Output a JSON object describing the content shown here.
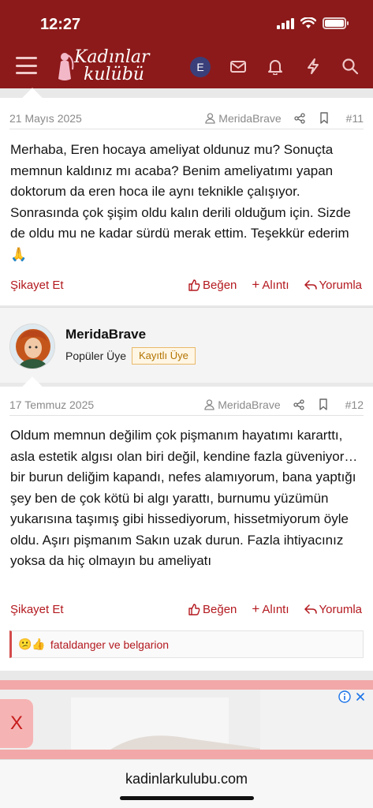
{
  "status_bar": {
    "time": "12:27"
  },
  "header": {
    "logo_line1": "Kadınlar",
    "logo_line2": "kulübü",
    "user_initial": "E"
  },
  "posts": [
    {
      "date": "21 Mayıs 2025",
      "author": "MeridaBrave",
      "number": "#11",
      "body": "Merhaba, Eren hocaya ameliyat oldunuz mu? Sonuçta memnun kaldınız mı acaba? Benim ameliyatımı yapan doktorum da eren hoca ile aynı teknikle çalışıyor. Sonrasında çok şişim oldu kalın derili olduğum için. Sizde de oldu mu ne kadar sürdü merak ettim. Teşekkür ederim 🙏",
      "report": "Şikayet Et",
      "like": "Beğen",
      "quote": "Alıntı",
      "reply": "Yorumla"
    },
    {
      "date": "17 Temmuz 2025",
      "author": "MeridaBrave",
      "number": "#12",
      "body": "Oldum memnun değilim çok pişmanım hayatımı kararttı, asla estetik algısı olan biri değil, kendine fazla güveniyor… bir burun deliğim kapandı, nefes alamıyorum, bana yaptığı şey ben de çok kötü bi algı yarattı, burnumu yüzümün yukarısına taşımış gibi hissediyorum, hissetmiyorum öyle oldu. Aşırı pişmanım Sakın uzak durun. Fazla ihtiyacınız yoksa da hiç olmayın bu ameliyatı",
      "report": "Şikayet Et",
      "like": "Beğen",
      "quote": "Alıntı",
      "reply": "Yorumla"
    }
  ],
  "user": {
    "name": "MeridaBrave",
    "title": "Popüler Üye",
    "badge": "Kayıtlı Üye"
  },
  "reactions": {
    "emojis": "😕👍",
    "text": "fataldanger ve belgarion"
  },
  "ad": {
    "close": "X"
  },
  "browser": {
    "url": "kadinlarkulubu.com"
  },
  "colors": {
    "brand": "#8c1a1a",
    "accent": "#b3191f"
  }
}
